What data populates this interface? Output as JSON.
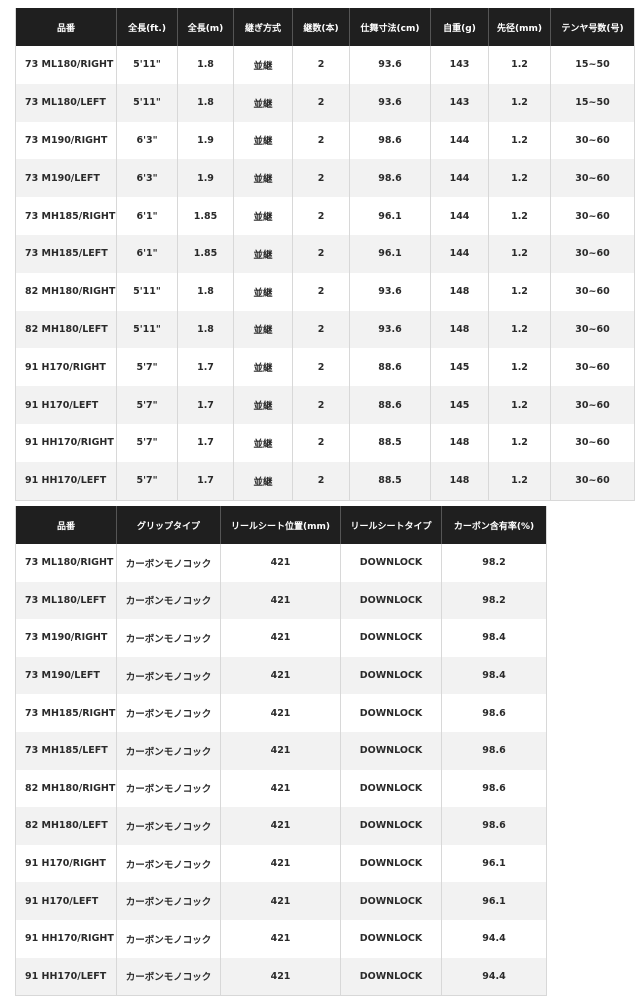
{
  "table1": {
    "headers": [
      "品番",
      "全長(ft.)",
      "全長(m)",
      "継ぎ方式",
      "継数(本)",
      "仕舞寸法(cm)",
      "自重(g)",
      "先径(mm)",
      "テンヤ号数(号)"
    ],
    "rows": [
      [
        "73 ML180/RIGHT",
        "5'11\"",
        "1.8",
        "並継",
        "2",
        "93.6",
        "143",
        "1.2",
        "15~50"
      ],
      [
        "73 ML180/LEFT",
        "5'11\"",
        "1.8",
        "並継",
        "2",
        "93.6",
        "143",
        "1.2",
        "15~50"
      ],
      [
        "73 M190/RIGHT",
        "6'3\"",
        "1.9",
        "並継",
        "2",
        "98.6",
        "144",
        "1.2",
        "30~60"
      ],
      [
        "73 M190/LEFT",
        "6'3\"",
        "1.9",
        "並継",
        "2",
        "98.6",
        "144",
        "1.2",
        "30~60"
      ],
      [
        "73 MH185/RIGHT",
        "6'1\"",
        "1.85",
        "並継",
        "2",
        "96.1",
        "144",
        "1.2",
        "30~60"
      ],
      [
        "73 MH185/LEFT",
        "6'1\"",
        "1.85",
        "並継",
        "2",
        "96.1",
        "144",
        "1.2",
        "30~60"
      ],
      [
        "82 MH180/RIGHT",
        "5'11\"",
        "1.8",
        "並継",
        "2",
        "93.6",
        "148",
        "1.2",
        "30~60"
      ],
      [
        "82 MH180/LEFT",
        "5'11\"",
        "1.8",
        "並継",
        "2",
        "93.6",
        "148",
        "1.2",
        "30~60"
      ],
      [
        "91 H170/RIGHT",
        "5'7\"",
        "1.7",
        "並継",
        "2",
        "88.6",
        "145",
        "1.2",
        "30~60"
      ],
      [
        "91 H170/LEFT",
        "5'7\"",
        "1.7",
        "並継",
        "2",
        "88.6",
        "145",
        "1.2",
        "30~60"
      ],
      [
        "91 HH170/RIGHT",
        "5'7\"",
        "1.7",
        "並継",
        "2",
        "88.5",
        "148",
        "1.2",
        "30~60"
      ],
      [
        "91 HH170/LEFT",
        "5'7\"",
        "1.7",
        "並継",
        "2",
        "88.5",
        "148",
        "1.2",
        "30~60"
      ]
    ]
  },
  "table2": {
    "headers": [
      "品番",
      "グリップタイプ",
      "リールシート位置(mm)",
      "リールシートタイプ",
      "カーボン含有率(%)"
    ],
    "rows": [
      [
        "73 ML180/RIGHT",
        "カーボンモノコック",
        "421",
        "DOWNLOCK",
        "98.2"
      ],
      [
        "73 ML180/LEFT",
        "カーボンモノコック",
        "421",
        "DOWNLOCK",
        "98.2"
      ],
      [
        "73 M190/RIGHT",
        "カーボンモノコック",
        "421",
        "DOWNLOCK",
        "98.4"
      ],
      [
        "73 M190/LEFT",
        "カーボンモノコック",
        "421",
        "DOWNLOCK",
        "98.4"
      ],
      [
        "73 MH185/RIGHT",
        "カーボンモノコック",
        "421",
        "DOWNLOCK",
        "98.6"
      ],
      [
        "73 MH185/LEFT",
        "カーボンモノコック",
        "421",
        "DOWNLOCK",
        "98.6"
      ],
      [
        "82 MH180/RIGHT",
        "カーボンモノコック",
        "421",
        "DOWNLOCK",
        "98.6"
      ],
      [
        "82 MH180/LEFT",
        "カーボンモノコック",
        "421",
        "DOWNLOCK",
        "98.6"
      ],
      [
        "91 H170/RIGHT",
        "カーボンモノコック",
        "421",
        "DOWNLOCK",
        "96.1"
      ],
      [
        "91 H170/LEFT",
        "カーボンモノコック",
        "421",
        "DOWNLOCK",
        "96.1"
      ],
      [
        "91 HH170/RIGHT",
        "カーボンモノコック",
        "421",
        "DOWNLOCK",
        "94.4"
      ],
      [
        "91 HH170/LEFT",
        "カーボンモノコック",
        "421",
        "DOWNLOCK",
        "94.4"
      ]
    ]
  }
}
